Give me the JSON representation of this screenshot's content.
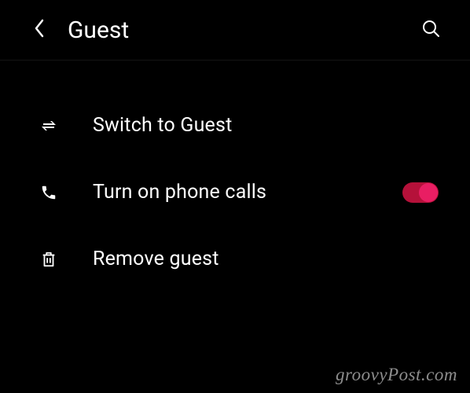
{
  "header": {
    "title": "Guest"
  },
  "items": [
    {
      "label": "Switch to Guest"
    },
    {
      "label": "Turn on phone calls",
      "toggle": true
    },
    {
      "label": "Remove guest"
    }
  ],
  "watermark": "groovyPost.com",
  "colors": {
    "toggleTrack": "#b5113a",
    "toggleKnob": "#e91e63"
  }
}
